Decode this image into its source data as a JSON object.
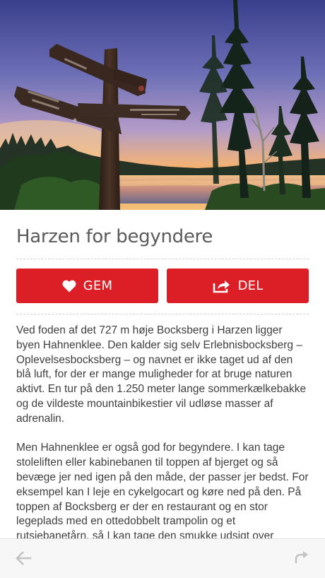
{
  "article": {
    "title": "Harzen for begyndere",
    "paragraphs": [
      "Ved foden af det 727 m høje Bocksberg i Harzen ligger byen Hahnenklee. Den kalder sig selv Erlebnisbocksberg – Oplevelsesbocksberg – og navnet er ikke taget ud af den blå luft, for der er mange muligheder for at bruge naturen aktivt. En tur på den 1.250 meter lange sommerkælkebakke og de vildeste mountainbikestier vil udløse masser af adrenalin.",
      "Men Hahnenklee er også god for begyndere. I kan tage stoleliften eller kabinebanen til toppen af bjerget og så bevæge jer ned igen på den måde, der passer jer bedst. For eksempel kan I leje en cykelgocart og køre ned på den. På toppen af Bocksberg er der en restaurant og en stor legeplads med en ottedobbelt trampolin og et rutsjebanetårn, så I kan tage den smukke udsigt over Harzen til nye højder."
    ]
  },
  "actions": {
    "save_label": "GEM",
    "save_icon": "heart-icon",
    "share_label": "DEL",
    "share_icon": "share-icon",
    "button_color": "#dc1f26"
  },
  "hero": {
    "signpost_lines": [
      "Wanderweg",
      "Parkplatz Rosstrappe",
      "Rundwanderweg Bergstrasse",
      "Kreuzungs"
    ],
    "sign_lettering_note": "blurred"
  },
  "navigation": {
    "back_icon": "arrow-left-icon",
    "forward_icon": "share-forward-icon"
  }
}
